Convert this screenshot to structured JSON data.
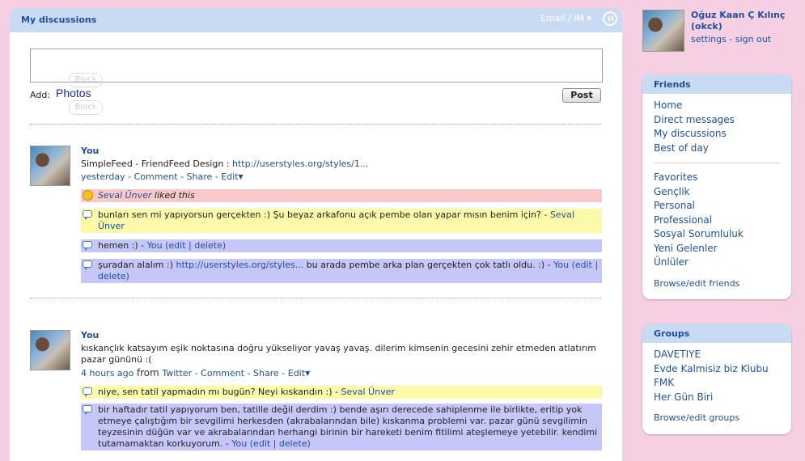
{
  "main": {
    "title": "My discussions",
    "email_im": "Email / IM ▾",
    "add_label": "Add:",
    "photos_link": "Photos",
    "block_ghost": "Block",
    "post_button": "Post"
  },
  "entries": [
    {
      "author": "You",
      "text": "SimpleFeed - FriendFeed Design :",
      "link": "http://userstyles.org/styles/1...",
      "time": "yesterday",
      "from_label": "",
      "source": "",
      "actions": [
        "Comment",
        "Share",
        "Edit"
      ],
      "like": {
        "user": "Seval Ünver",
        "text": "liked this"
      },
      "comments": [
        {
          "color": "yellow",
          "text": "bunları sen mi yapıyorsun gerçekten :) Şu beyaz arkafonu açık pembe olan yapar mısın benim için? -",
          "author": "Seval Ünver",
          "extra": ""
        },
        {
          "color": "purple",
          "text": "hemen :) -",
          "author": "You",
          "extra": "(edit | delete)"
        },
        {
          "color": "purple",
          "text": "şuradan alalım :)",
          "link": "http://userstyles.org/styles...",
          "text2": "bu arada pembe arka plan gerçekten çok tatlı oldu. :) -",
          "author": "You",
          "extra": "(edit | delete)"
        }
      ]
    },
    {
      "author": "You",
      "text": "kıskançlık katsayım eşik noktasına doğru yükseliyor yavaş yavaş. dilerim kimsenin gecesini zehir etmeden atlatırım pazar gününü :(",
      "time": "4 hours ago",
      "from_label": "from",
      "source": "Twitter",
      "actions": [
        "Comment",
        "Share",
        "Edit"
      ],
      "comments": [
        {
          "color": "yellow",
          "text": "niye, sen tatil yapmadın mı bugün? Neyi kıskandın :) -",
          "author": "Seval Ünver",
          "extra": ""
        },
        {
          "color": "purple",
          "text": "bir haftadır tatil yapıyorum ben, tatille değil derdim :) bende aşırı derecede sahiplenme ile birlikte, eritip yok etmeye çalıştığım bir sevgilimi herkesden (akrabalarından bile) kıskanma problemi var. pazar günü sevgilimin teyzesinin düğün var ve akrabalarından herhangi birinin bir hareketi benim fitilimi ateşlemeye yetebilir. kendimi tutamamaktan korkuyorum. -",
          "author": "You",
          "extra": "(edit | delete)"
        }
      ]
    }
  ],
  "profile": {
    "name": "Oğuz Kaan Ç Kılınç (okck)",
    "settings": "settings",
    "sep": "-",
    "signout": "sign out"
  },
  "friends_box": {
    "title": "Friends",
    "items1": [
      "Home",
      "Direct messages",
      "My discussions",
      "Best of day"
    ],
    "items2": [
      "Favorites",
      "Gençlik",
      "Personal",
      "Professional",
      "Sosyal Sorumluluk",
      "Yeni Gelenler",
      "Ünlüler"
    ],
    "footer": "Browse/edit friends"
  },
  "groups_box": {
    "title": "Groups",
    "items": [
      "DAVETIYE",
      "Evde Kalmisiz biz Klubu",
      "FMK",
      "Her Gün Biri"
    ],
    "footer": "Browse/edit groups"
  }
}
